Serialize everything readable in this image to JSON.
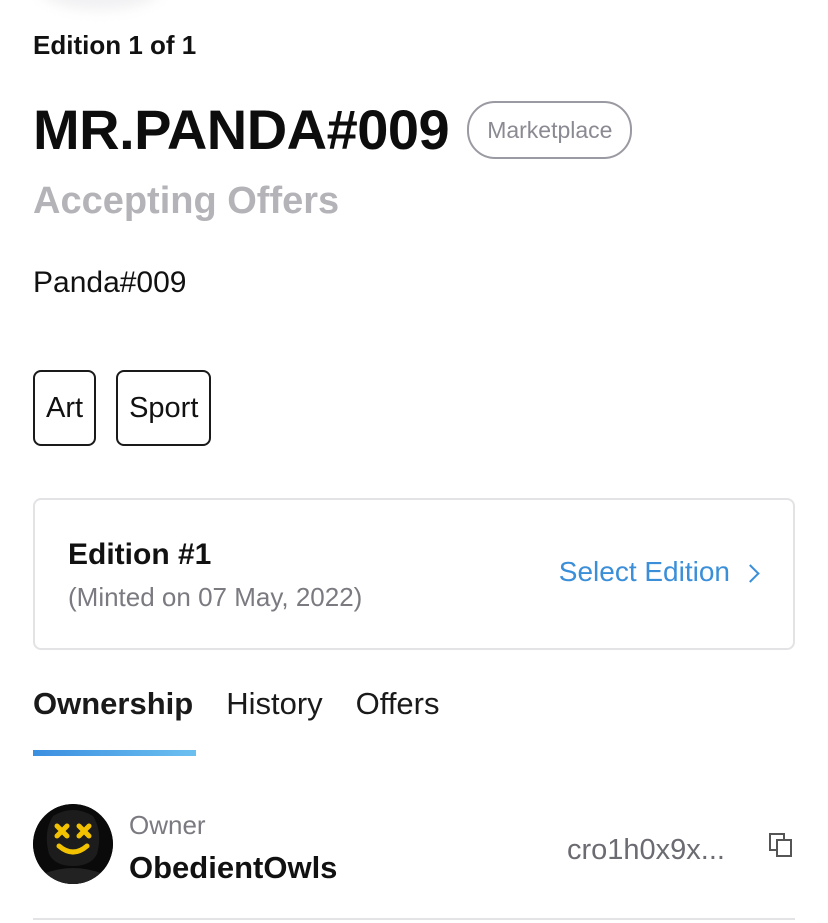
{
  "edition_count": "Edition 1 of 1",
  "title": "MR.PANDA#009",
  "badge": "Marketplace",
  "status": "Accepting Offers",
  "description": "Panda#009",
  "tags": [
    "Art",
    "Sport"
  ],
  "edition_card": {
    "name": "Edition #1",
    "minted": "(Minted on 07 May, 2022)",
    "select_label": "Select Edition"
  },
  "tabs": [
    {
      "label": "Ownership",
      "active": true
    },
    {
      "label": "History",
      "active": false
    },
    {
      "label": "Offers",
      "active": false
    }
  ],
  "owner": {
    "label": "Owner",
    "name": "ObedientOwls",
    "address": "cro1h0x9x..."
  },
  "colors": {
    "accent": "#3b8fd9",
    "muted": "#b3b3b8",
    "avatar_bg": "#0a0a0a",
    "avatar_face": "#f2c200"
  },
  "icons": {
    "select_chevron": "chevron-right-icon",
    "copy": "copy-icon",
    "avatar": "marshmello-avatar-icon"
  }
}
